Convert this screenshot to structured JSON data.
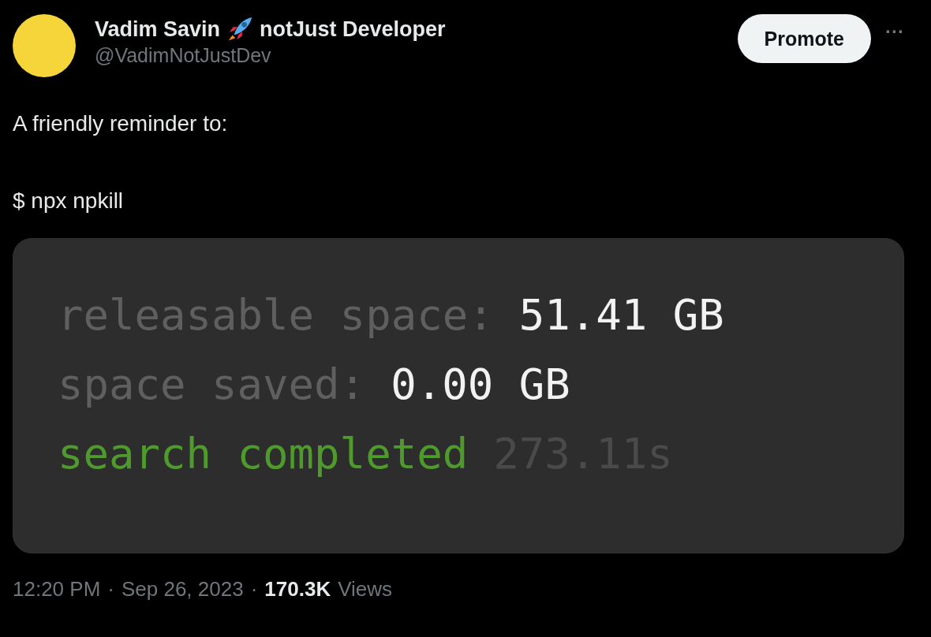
{
  "author": {
    "name": "Vadim Savin",
    "name_suffix": "notJust Developer",
    "handle": "@VadimNotJustDev"
  },
  "promote_button": "Promote",
  "more_button": "···",
  "body": [
    "A friendly reminder to:",
    "$ npx npkill"
  ],
  "terminal_lines": [
    [
      {
        "kind": "label",
        "text": "releasable space:"
      },
      {
        "kind": "value",
        "text": "51.41 GB"
      }
    ],
    [
      {
        "kind": "label",
        "text": "space saved:"
      },
      {
        "kind": "value",
        "text": "0.00 GB"
      }
    ],
    [
      {
        "kind": "status",
        "text": "search completed"
      },
      {
        "kind": "dim",
        "text": "273.11s"
      }
    ]
  ],
  "footer": [
    {
      "kind": "meta",
      "text": "12:20 PM"
    },
    {
      "kind": "meta",
      "text": "·"
    },
    {
      "kind": "meta",
      "text": "Sep 26, 2023"
    },
    {
      "kind": "meta",
      "text": "·"
    },
    {
      "kind": "count",
      "text": "170.3K"
    },
    {
      "kind": "meta",
      "text": "Views"
    }
  ]
}
